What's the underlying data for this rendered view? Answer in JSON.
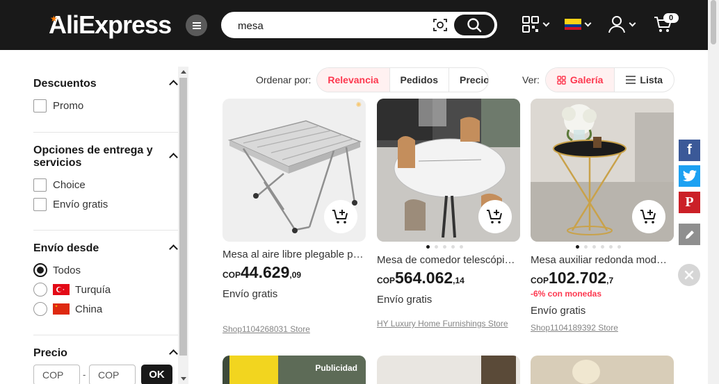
{
  "header": {
    "logo": "AliExpress",
    "search_value": "mesa",
    "cart_count": "0"
  },
  "sidebar": {
    "discounts_title": "Descuentos",
    "promo_label": "Promo",
    "delivery_title": "Opciones de entrega y servicios",
    "choice_label": "Choice",
    "free_shipping_label": "Envío gratis",
    "ship_from_title": "Envío desde",
    "all_label": "Todos",
    "turkey_label": "Turquía",
    "china_label": "China",
    "price_title": "Precio",
    "min_placeholder": "COP",
    "max_placeholder": "COP",
    "dash": "-",
    "ok_label": "OK"
  },
  "sort": {
    "label": "Ordenar por:",
    "options": [
      "Relevancia",
      "Pedidos",
      "Precio"
    ],
    "active": "Relevancia"
  },
  "view": {
    "label": "Ver:",
    "gallery": "Galería",
    "list": "Lista"
  },
  "products": [
    {
      "title": "Mesa al aire libre plegable portátil",
      "currency": "COP",
      "price_int": "44.629",
      "price_dec": ",09",
      "shipping": "Envío gratis",
      "store": "Shop1104268031 Store"
    },
    {
      "title": "Mesa de comedor telescópica extensible",
      "currency": "COP",
      "price_int": "564.062",
      "price_dec": ",14",
      "shipping": "Envío gratis",
      "store": "HY Luxury Home Furnishings Store"
    },
    {
      "title": "Mesa auxiliar redonda moderna de lujo",
      "currency": "COP",
      "price_int": "102.702",
      "price_dec": ",7",
      "discount": "-6% con monedas",
      "shipping": "Envío gratis",
      "store": "Shop1104189392 Store"
    }
  ],
  "ad_label": "Publicidad",
  "colors": {
    "accent": "#fd384f",
    "header_bg": "#191919",
    "facebook": "#3b5998",
    "twitter": "#1da1f2",
    "pinterest": "#cb2027"
  }
}
